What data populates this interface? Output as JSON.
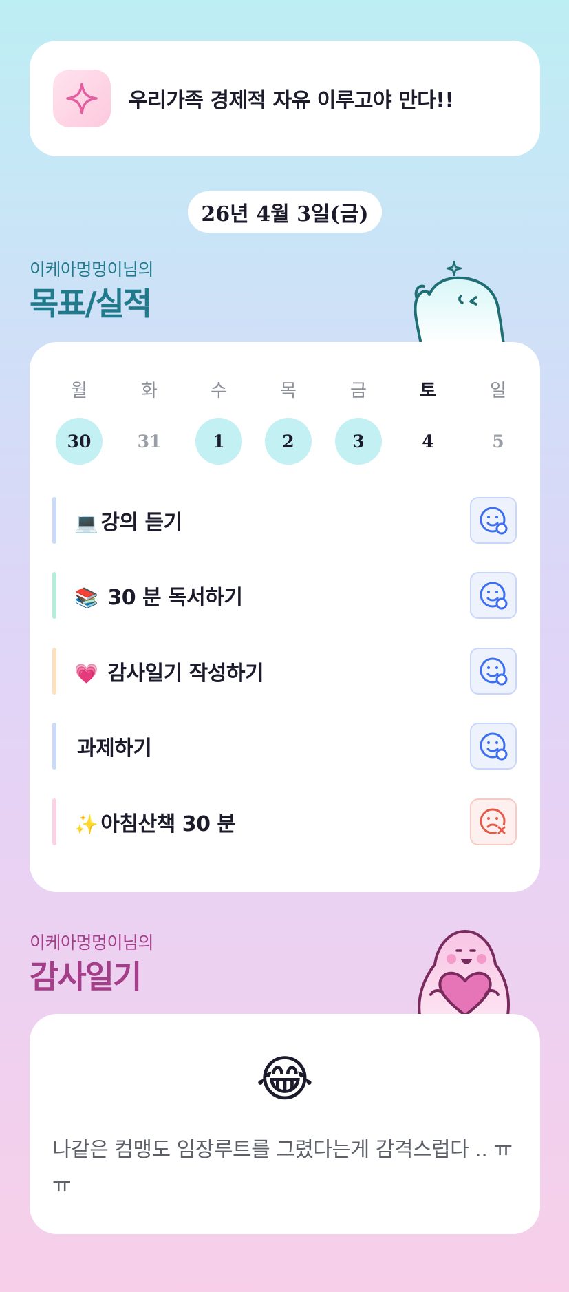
{
  "motto": {
    "icon": "sparkle-icon",
    "text": "우리가족 경제적 자유 이루고야 만다!!"
  },
  "date": "26년 4월 3일(금)",
  "goals_section": {
    "subtitle": "이케아멍멍이님의",
    "title": "목표/실적"
  },
  "calendar": {
    "weekdays": [
      {
        "label": "월",
        "today": false
      },
      {
        "label": "화",
        "today": false
      },
      {
        "label": "수",
        "today": false
      },
      {
        "label": "목",
        "today": false
      },
      {
        "label": "금",
        "today": false
      },
      {
        "label": "토",
        "today": true
      },
      {
        "label": "일",
        "today": false
      }
    ],
    "days": [
      {
        "label": "30",
        "state": "done"
      },
      {
        "label": "31",
        "state": "muted"
      },
      {
        "label": "1",
        "state": "done"
      },
      {
        "label": "2",
        "state": "done"
      },
      {
        "label": "3",
        "state": "done"
      },
      {
        "label": "4",
        "state": "normal"
      },
      {
        "label": "5",
        "state": "muted"
      }
    ]
  },
  "tasks": [
    {
      "emoji": "💻",
      "label": "강의 듣기",
      "bar_color": "#c9d9f7",
      "status": "smile-icon"
    },
    {
      "emoji": "📚",
      "label": " 30 분 독서하기",
      "bar_color": "#b7ecd9",
      "status": "smile-icon"
    },
    {
      "emoji": "💗",
      "label": " 감사일기 작성하기",
      "bar_color": "#fde1bf",
      "status": "smile-icon"
    },
    {
      "emoji": "",
      "label": "과제하기",
      "bar_color": "#c9d9f7",
      "status": "smile-icon"
    },
    {
      "emoji": "✨",
      "label": "아침산책 30 분",
      "bar_color": "#fbd1e6",
      "status": "frown-icon"
    }
  ],
  "gratitude_section": {
    "subtitle": "이케아멍멍이님의",
    "title": "감사일기",
    "emoji": "😂",
    "text": "나같은 컴맹도 임장루트를 그렸다는게 감격스럽다 .. ㅠㅠ"
  },
  "colors": {
    "teal_heading": "#207a8c",
    "pink_heading": "#a53e88",
    "done_circle": "#c2f0f3",
    "smile_icon": "#3c6ff0",
    "frown_icon": "#e5594a"
  }
}
